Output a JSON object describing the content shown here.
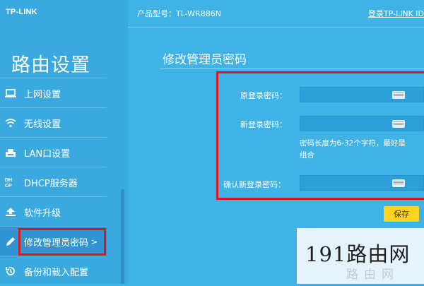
{
  "brand": {
    "logo": "TP-LINK"
  },
  "header": {
    "model_label": "产品型号：TL-WR886N",
    "login_link": "登录TP-LINK ID"
  },
  "sidebar": {
    "title": "路由设置",
    "items": [
      {
        "label": "上网设置",
        "icon": "laptop-icon"
      },
      {
        "label": "无线设置",
        "icon": "wifi-icon"
      },
      {
        "label": "LAN口设置",
        "icon": "lan-icon"
      },
      {
        "label": "DHCP服务器",
        "icon": "dhcp-icon"
      },
      {
        "label": "软件升级",
        "icon": "upload-icon"
      },
      {
        "label": "修改管理员密码",
        "icon": "pencil-icon",
        "active": true,
        "chevron": ">"
      },
      {
        "label": "备份和载入配置",
        "icon": "restore-icon"
      }
    ]
  },
  "main": {
    "section_title": "修改管理员密码",
    "fields": [
      {
        "label": "原登录密码：",
        "value": ""
      },
      {
        "label": "新登录密码：",
        "value": ""
      },
      {
        "label": "确认新登录密码：",
        "value": ""
      }
    ],
    "hint_line1": "密码长度为6-32个字符，最好是",
    "hint_line2": "组合",
    "save_label": "保存"
  },
  "watermark": {
    "text": "191路由网",
    "faint": "路由网"
  },
  "colors": {
    "background": "#40b3e6",
    "active_item": "#2f95d2",
    "highlight_box": "#e0141e",
    "save_button": "#ffd320"
  }
}
